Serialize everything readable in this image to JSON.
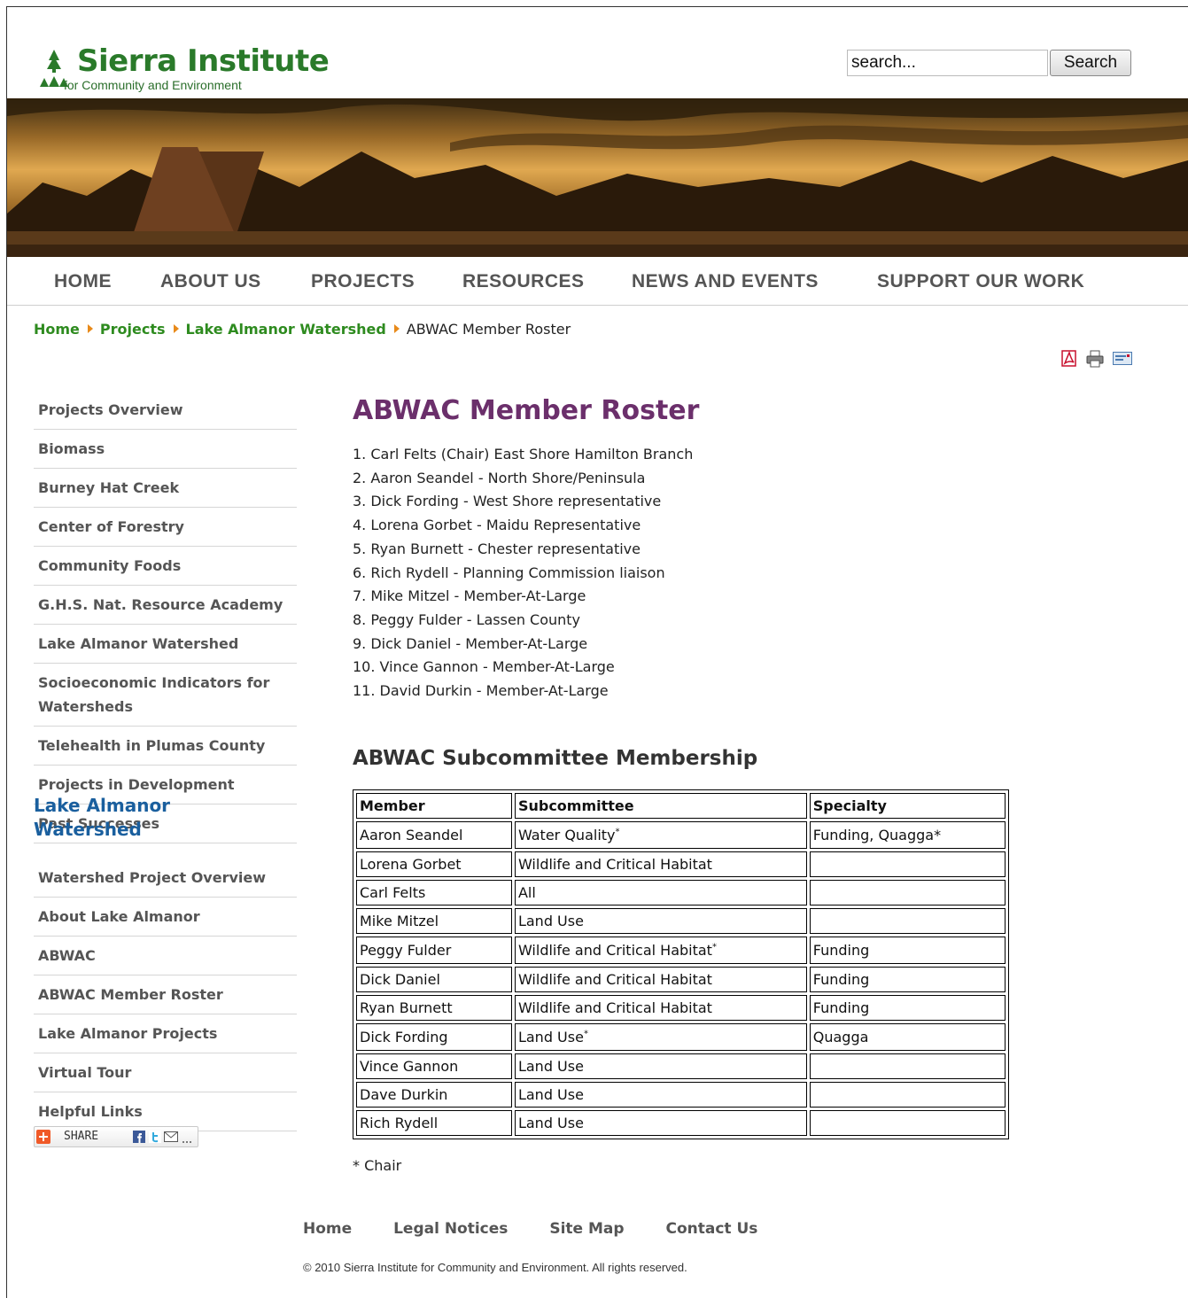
{
  "header": {
    "logo_title": "Sierra Institute",
    "logo_subtitle": "for Community and Environment",
    "search_placeholder": "search...",
    "search_button": "Search"
  },
  "nav": {
    "items": [
      "HOME",
      "ABOUT US",
      "PROJECTS",
      "RESOURCES",
      "NEWS AND EVENTS",
      "SUPPORT OUR WORK"
    ]
  },
  "breadcrumb": {
    "links": [
      "Home",
      "Projects",
      "Lake Almanor Watershed"
    ],
    "current": "ABWAC Member Roster"
  },
  "tools": {
    "icons": [
      "pdf-icon",
      "print-icon",
      "email-icon"
    ]
  },
  "sidebar": {
    "items": [
      "Projects Overview",
      "Biomass",
      "Burney Hat Creek",
      "Center of Forestry",
      "Community Foods",
      "G.H.S. Nat. Resource Academy",
      "Lake Almanor Watershed",
      "Socioeconomic Indicators for Watersheds",
      "Telehealth in Plumas County",
      "Projects in Development",
      "Past Successes"
    ],
    "section_heading": "Lake Almanor Watershed",
    "section_items": [
      "Watershed Project Overview",
      "About Lake Almanor",
      "ABWAC",
      "ABWAC Member Roster",
      "Lake Almanor Projects",
      "Virtual Tour",
      "Helpful Links"
    ],
    "share_label": "SHARE"
  },
  "content": {
    "title": "ABWAC Member Roster",
    "roster": [
      "1. Carl Felts (Chair) East Shore Hamilton Branch",
      "2. Aaron Seandel - North Shore/Peninsula",
      "3. Dick Fording - West Shore representative",
      "4. Lorena Gorbet - Maidu Representative",
      "5. Ryan Burnett - Chester representative",
      "6. Rich Rydell - Planning Commission liaison",
      "7. Mike Mitzel - Member-At-Large",
      "8. Peggy Fulder - Lassen County",
      "9. Dick Daniel - Member-At-Large",
      "10. Vince Gannon - Member-At-Large",
      "11. David Durkin - Member-At-Large"
    ],
    "subcommittee_heading": "ABWAC Subcommittee Membership",
    "table": {
      "headers": [
        "Member",
        "Subcommittee",
        "Specialty"
      ],
      "rows": [
        {
          "member": "Aaron Seandel",
          "subcommittee": "Water Quality",
          "sup": "*",
          "specialty": "Funding, Quagga*"
        },
        {
          "member": "Lorena Gorbet",
          "subcommittee": "Wildlife and Critical Habitat",
          "sup": "",
          "specialty": ""
        },
        {
          "member": "Carl Felts",
          "subcommittee": "All",
          "sup": "",
          "specialty": ""
        },
        {
          "member": "Mike Mitzel",
          "subcommittee": "Land Use",
          "sup": "",
          "specialty": ""
        },
        {
          "member": "Peggy Fulder",
          "subcommittee": "Wildlife and Critical Habitat",
          "sup": "*",
          "specialty": "Funding"
        },
        {
          "member": "Dick Daniel",
          "subcommittee": "Wildlife and Critical Habitat",
          "sup": "",
          "specialty": "Funding"
        },
        {
          "member": "Ryan Burnett",
          "subcommittee": "Wildlife and Critical Habitat",
          "sup": "",
          "specialty": "Funding"
        },
        {
          "member": "Dick Fording",
          "subcommittee": "Land Use",
          "sup": "*",
          "specialty": "Quagga"
        },
        {
          "member": "Vince Gannon",
          "subcommittee": "Land Use",
          "sup": "",
          "specialty": ""
        },
        {
          "member": "Dave Durkin",
          "subcommittee": "Land Use",
          "sup": "",
          "specialty": ""
        },
        {
          "member": "Rich Rydell",
          "subcommittee": "Land Use",
          "sup": "",
          "specialty": ""
        }
      ]
    },
    "footnote": "* Chair"
  },
  "footer": {
    "links": [
      "Home",
      "Legal Notices",
      "Site Map",
      "Contact Us"
    ],
    "copyright": "© 2010 Sierra Institute for Community and Environment. All rights reserved."
  },
  "colors": {
    "logo_green": "#2a7a2a",
    "breadcrumb_link": "#2e8b1f",
    "breadcrumb_arrow": "#e88a1a",
    "title_purple": "#6b2f6b",
    "section_heading_blue": "#1a5f9e",
    "nav_text": "#555555"
  }
}
